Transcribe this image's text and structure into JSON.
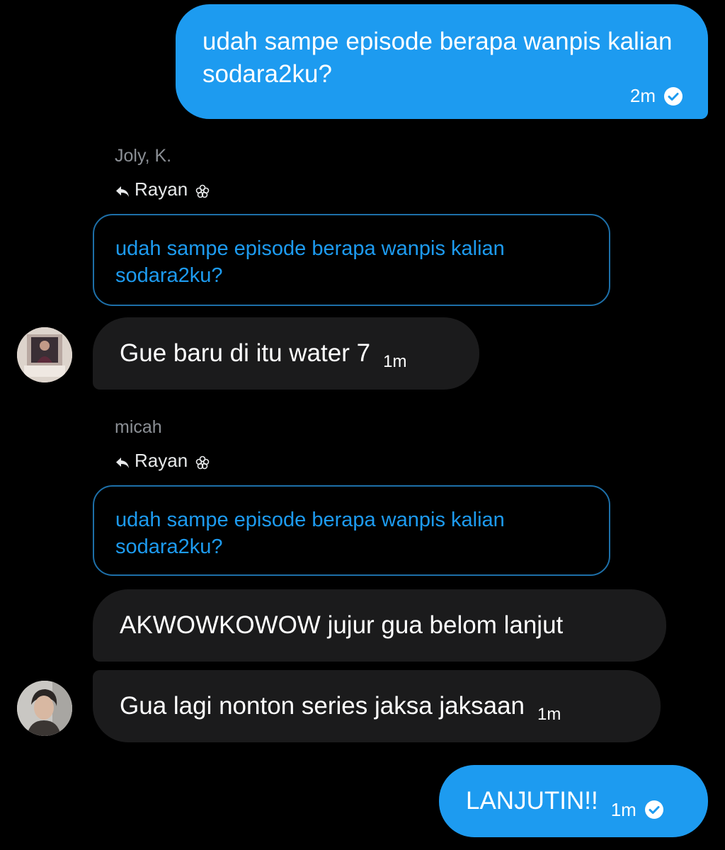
{
  "messages": {
    "m1": {
      "text": "udah sampe episode berapa wanpis kalian sodara2ku?",
      "time": "2m"
    },
    "group1": {
      "sender": "Joly, K.",
      "reply_to": "Rayan",
      "quote": "udah sampe episode berapa wanpis kalian sodara2ku?",
      "bubble": {
        "text": "Gue baru di itu water 7",
        "time": "1m"
      }
    },
    "group2": {
      "sender": "micah",
      "reply_to": "Rayan",
      "quote": "udah sampe episode berapa wanpis kalian sodara2ku?",
      "bubble1": {
        "text": "AKWOWKOWOW jujur gua belom lanjut"
      },
      "bubble2": {
        "text": "Gua lagi nonton series jaksa jaksaan",
        "time": "1m"
      }
    },
    "m_last": {
      "text": "LANJUTIN!!",
      "time": "1m"
    }
  },
  "icons": {
    "read_check": "check-circle-icon",
    "reply": "reply-arrow-icon",
    "flower": "flower-icon"
  },
  "colors": {
    "accent": "#1d9bf0",
    "background": "#000000",
    "incoming_bubble": "#1b1b1c",
    "muted_text": "#8b8f95"
  }
}
